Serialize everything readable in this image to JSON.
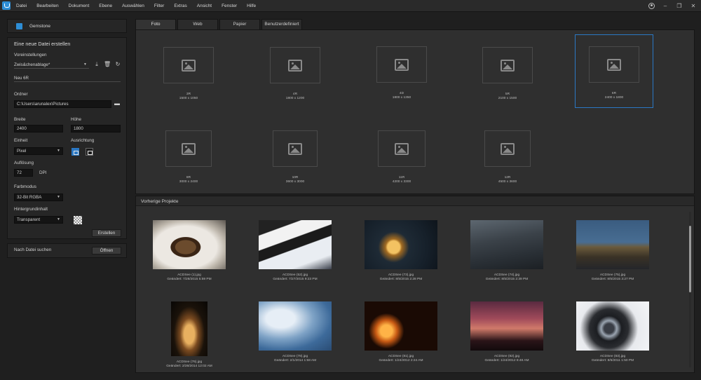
{
  "menubar": {
    "items": [
      "Datei",
      "Bearbeiten",
      "Dokument",
      "Ebene",
      "Auswählen",
      "Filter",
      "Extras",
      "Ansicht",
      "Fenster",
      "Hilfe"
    ]
  },
  "sidebar": {
    "brand": "Gemstone",
    "new_file_title": "Eine neue Datei erstellen",
    "presets_label": "Voreinstellungen",
    "preset_value": "Zwis&chenablage*",
    "name_value": "Neu 6R",
    "folder_label": "Ordner",
    "folder_value": "C:\\Users\\arunalex\\Pictures",
    "width_label": "Breite",
    "width_value": "2400",
    "height_label": "Höhe",
    "height_value": "1800",
    "unit_label": "Einheit",
    "unit_value": "Pixel",
    "orientation_label": "Ausrichtung",
    "resolution_label": "Auflösung",
    "resolution_value": "72",
    "resolution_unit": "DPI",
    "colormode_label": "Farbmodus",
    "colormode_value": "32-Bit RGBA",
    "background_label": "Hintergrundinhalt",
    "background_value": "Transparent",
    "create_button": "Erstellen",
    "search_label": "Nach Datei suchen",
    "open_button": "Öffnen"
  },
  "tabs": [
    "Foto",
    "Web",
    "Papier",
    "Benutzerdefiniert"
  ],
  "templates": [
    {
      "name": "3R",
      "size": "1500 x 1050"
    },
    {
      "name": "4R",
      "size": "1800 x 1200"
    },
    {
      "name": "4D",
      "size": "1800 x 1350"
    },
    {
      "name": "5R",
      "size": "2100 x 1500"
    },
    {
      "name": "6R",
      "size": "2400 x 1800",
      "selected": true
    },
    {
      "name": "8R",
      "size": "3000 x 2400"
    },
    {
      "name": "10R",
      "size": "3600 x 3000"
    },
    {
      "name": "11R",
      "size": "4200 x 3300"
    },
    {
      "name": "12R",
      "size": "4500 x 3600"
    }
  ],
  "recent": {
    "title": "Vorherige Projekte",
    "items": [
      {
        "name": "ACDSee (1).jpg",
        "date": "Geändert: 7/28/2015 5:59 PM"
      },
      {
        "name": "ACDSee (52).jpg",
        "date": "Geändert: 7/27/2015 9:23 PM"
      },
      {
        "name": "ACDSee (73).jpg",
        "date": "Geändert: 8/5/2015 2:28 PM"
      },
      {
        "name": "ACDSee (74).jpg",
        "date": "Geändert: 8/5/2015 2:39 PM"
      },
      {
        "name": "ACDSee (75).jpg",
        "date": "Geändert: 8/5/2015 3:27 PM"
      },
      {
        "name": "ACDSee (76).jpg",
        "date": "Geändert: 2/28/2014 12:02 AM"
      },
      {
        "name": "ACDSee (78).jpg",
        "date": "Geändert: 2/1/2014 1:58 AM"
      },
      {
        "name": "ACDSee (81).jpg",
        "date": "Geändert: 1/24/2012 2:24 AM"
      },
      {
        "name": "ACDSee (82).jpg",
        "date": "Geändert: 1/24/2012 8:48 AM"
      },
      {
        "name": "ACDSee (83).jpg",
        "date": "Geändert: 8/6/2011 1:50 PM"
      }
    ]
  }
}
